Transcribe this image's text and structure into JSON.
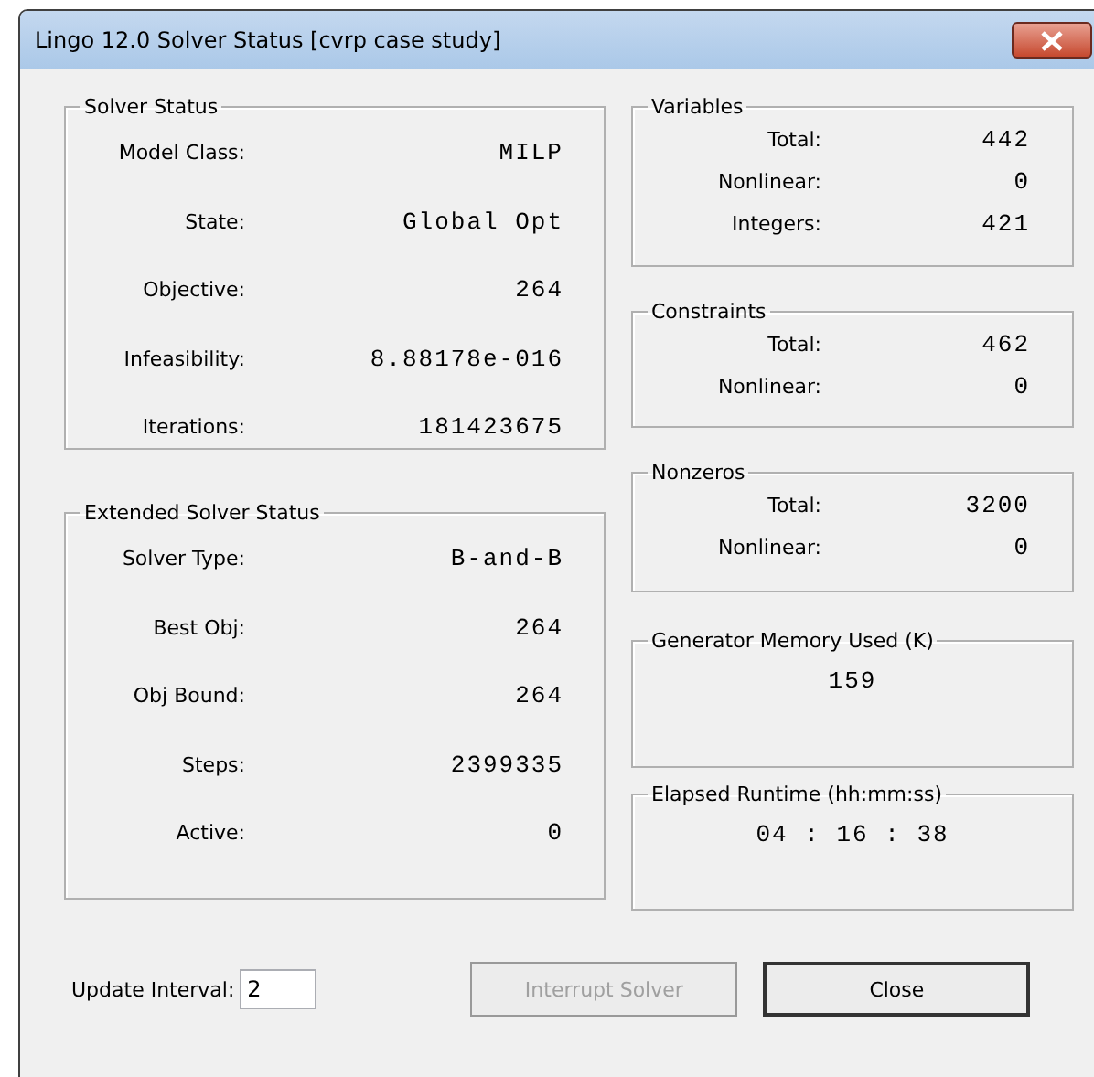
{
  "window": {
    "title": "Lingo 12.0 Solver Status [cvrp case study]"
  },
  "solver_status": {
    "title": "Solver Status",
    "rows": [
      {
        "label": "Model Class:",
        "value": "MILP"
      },
      {
        "label": "State:",
        "value": "Global Opt"
      },
      {
        "label": "Objective:",
        "value": "264"
      },
      {
        "label": "Infeasibility:",
        "value": "8.88178e-016"
      },
      {
        "label": "Iterations:",
        "value": "181423675"
      }
    ]
  },
  "extended_solver_status": {
    "title": "Extended Solver Status",
    "rows": [
      {
        "label": "Solver Type:",
        "value": "B-and-B"
      },
      {
        "label": "Best Obj:",
        "value": "264"
      },
      {
        "label": "Obj Bound:",
        "value": "264"
      },
      {
        "label": "Steps:",
        "value": "2399335"
      },
      {
        "label": "Active:",
        "value": "0"
      }
    ]
  },
  "variables": {
    "title": "Variables",
    "rows": [
      {
        "label": "Total:",
        "value": "442"
      },
      {
        "label": "Nonlinear:",
        "value": "0"
      },
      {
        "label": "Integers:",
        "value": "421"
      }
    ]
  },
  "constraints": {
    "title": "Constraints",
    "rows": [
      {
        "label": "Total:",
        "value": "462"
      },
      {
        "label": "Nonlinear:",
        "value": "0"
      }
    ]
  },
  "nonzeros": {
    "title": "Nonzeros",
    "rows": [
      {
        "label": "Total:",
        "value": "3200"
      },
      {
        "label": "Nonlinear:",
        "value": "0"
      }
    ]
  },
  "generator_memory": {
    "title": "Generator Memory Used (K)",
    "value": "159"
  },
  "elapsed_runtime": {
    "title": "Elapsed Runtime (hh:mm:ss)",
    "value": "04 : 16 : 38"
  },
  "update_interval": {
    "label": "Update Interval:",
    "value": "2"
  },
  "buttons": [
    {
      "label": "Interrupt Solver",
      "disabled": true,
      "default": false
    },
    {
      "label": "Close",
      "disabled": false,
      "default": true
    }
  ]
}
